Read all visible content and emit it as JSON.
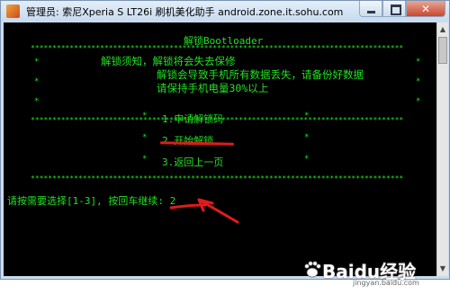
{
  "window": {
    "title": "管理员: 索尼Xperia S LT26i 刷机美化助手 android.zone.it.sohu.com",
    "min_label": "",
    "max_label": "",
    "close_label": "✕"
  },
  "console": {
    "title": "解锁Bootloader",
    "notice": [
      "解锁须知，解锁将会失去保修",
      "解锁会导致手机所有数据丢失，请备份好数据",
      "请保持手机电量30%以上"
    ],
    "menu": [
      "1.申请解锁码",
      "2.开始解锁",
      "3.返回上一页"
    ],
    "prompt": "请按需要选择[1-3], 按回车继续: 2"
  },
  "watermark": {
    "logo": "Baidu经验",
    "url": "jingyan.baidu.com"
  },
  "colors": {
    "console_bg": "#000000",
    "console_text": "#22e022",
    "annotation": "#e01b1b"
  }
}
